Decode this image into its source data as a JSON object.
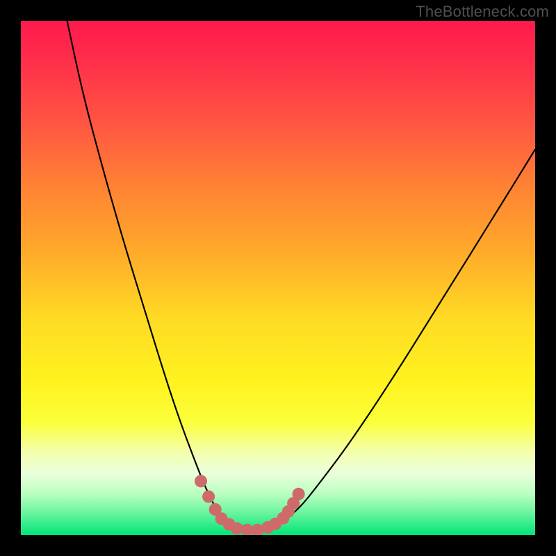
{
  "watermark": "TheBottleneck.com",
  "chart_data": {
    "type": "line",
    "title": "",
    "xlabel": "",
    "ylabel": "",
    "xlim": [
      0,
      100
    ],
    "ylim": [
      0,
      100
    ],
    "series": [
      {
        "name": "curve",
        "x": [
          9,
          12,
          16,
          20,
          24,
          28,
          31,
          34,
          36,
          38,
          40,
          43,
          47,
          50,
          54,
          58,
          64,
          72,
          82,
          92,
          100
        ],
        "y": [
          100,
          86,
          71,
          57,
          44,
          31,
          22,
          14,
          9,
          5,
          2,
          1,
          1,
          2,
          5,
          10,
          18,
          30,
          46,
          62,
          75
        ]
      }
    ],
    "highlight_points": {
      "x": [
        35,
        36.5,
        37.8,
        39,
        40.5,
        42,
        44,
        46,
        48,
        49.5,
        51,
        52,
        53,
        54
      ],
      "y": [
        10.5,
        7.5,
        5,
        3.2,
        2.1,
        1.3,
        1.0,
        1.0,
        1.5,
        2.2,
        3.3,
        4.6,
        6.2,
        8.0
      ]
    },
    "gradient_stops": [
      {
        "pos": 0,
        "color": "#ff1a4d"
      },
      {
        "pos": 70,
        "color": "#fff21f"
      },
      {
        "pos": 100,
        "color": "#00e47a"
      }
    ]
  }
}
